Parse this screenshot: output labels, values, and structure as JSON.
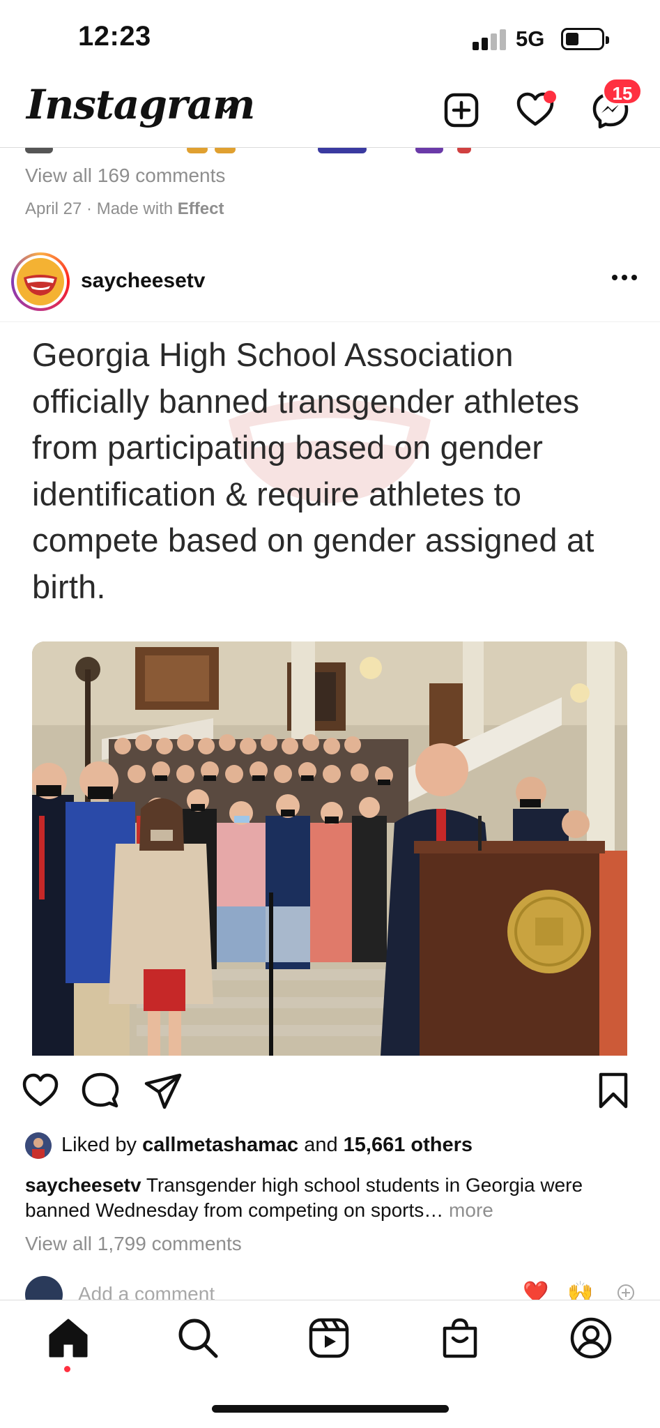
{
  "status_bar": {
    "time": "12:23",
    "network": "5G"
  },
  "header": {
    "logo": "Instagram",
    "messages_badge": "15",
    "icons": [
      "chevron-down-icon",
      "new-post-icon",
      "heart-icon",
      "messenger-icon"
    ]
  },
  "previous_post": {
    "view_all_comments": "View all 169 comments",
    "date_prefix": "April 27 · Made with ",
    "date_effect": "Effect"
  },
  "post": {
    "username": "saycheesetv",
    "headline": "Georgia High School Association officially banned transgender athletes from participating based on gender identification & require athletes to compete based on gender assigned at birth.",
    "liked_prefix": "Liked by ",
    "liked_user": "callmetashamac",
    "liked_mid": " and ",
    "liked_count": "15,661 others",
    "caption_user": "saycheesetv",
    "caption_text": " Transgender high school students in Georgia were banned Wednesday from competing on sports…",
    "caption_more": " more",
    "view_all_comments": "View all 1,799 comments",
    "add_comment_placeholder": "Add a comment",
    "quick_emojis": [
      "❤️",
      "🙌"
    ]
  },
  "bottom_nav": {
    "items": [
      "home-icon",
      "search-icon",
      "reels-icon",
      "shop-icon",
      "profile-icon"
    ]
  },
  "colors": {
    "notification": "#ff3040",
    "muted_text": "#8e8e8e"
  }
}
